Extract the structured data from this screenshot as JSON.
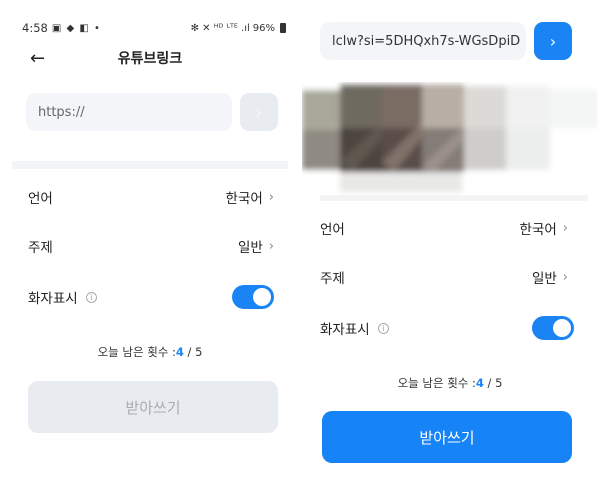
{
  "left": {
    "status_bar": {
      "time": "4:58",
      "left_icons": "▣ ◆ ◧ •",
      "right_icons": "✻ ✕ ᴴᴰ ᴸᵀᴱ .ıl",
      "battery": "96%"
    },
    "header": {
      "back_icon": "←",
      "title": "유튜브링크"
    },
    "url_input": {
      "placeholder": "https://",
      "go_icon": "›"
    },
    "rows": {
      "language": {
        "label": "언어",
        "value": "한국어",
        "chevron": "›"
      },
      "topic": {
        "label": "주제",
        "value": "일반",
        "chevron": "›"
      },
      "speaker": {
        "label": "화자표시",
        "info_icon": "i",
        "enabled": true
      }
    },
    "remaining": {
      "label": "오늘 남은 횟수 :",
      "used": "4",
      "sep": " / ",
      "total": "5"
    },
    "submit_label": "받아쓰기"
  },
  "right": {
    "url_input": {
      "value": "lclw?si=5DHQxh7s-WGsDpiD",
      "go_icon": "›"
    },
    "rows": {
      "language": {
        "label": "언어",
        "value": "한국어",
        "chevron": "›"
      },
      "topic": {
        "label": "주제",
        "value": "일반",
        "chevron": "›"
      },
      "speaker": {
        "label": "화자표시",
        "info_icon": "i",
        "enabled": true
      }
    },
    "remaining": {
      "label": "오늘 남은 횟수 :",
      "used": "4",
      "sep": " / ",
      "total": "5"
    },
    "submit_label": "받아쓰기"
  },
  "colors": {
    "accent": "#1a84f4",
    "disabled_button": "#e8ebef",
    "input_bg": "#f3f5f8"
  }
}
